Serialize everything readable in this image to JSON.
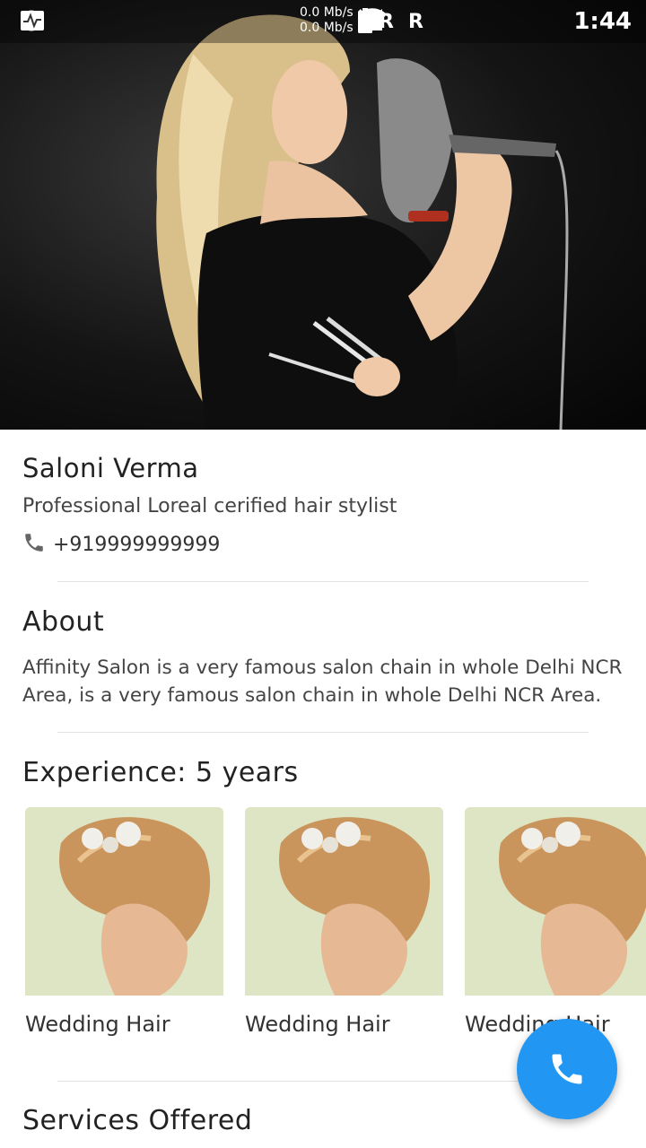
{
  "status_bar": {
    "speed_up": "0.0 Mb/s",
    "speed_down": "0.0 Mb/s",
    "roaming_1": "R",
    "roaming_2": "R",
    "time": "1:44"
  },
  "profile": {
    "name": "Saloni Verma",
    "subtitle": "Professional Loreal cerified hair stylist",
    "phone": "+919999999999"
  },
  "about": {
    "title": "About",
    "text": "Affinity Salon is a very famous salon chain in whole Delhi NCR Area, is a very famous salon chain in whole Delhi NCR Area."
  },
  "experience": {
    "title": "Experience: 5 years",
    "cards": [
      {
        "label": "Wedding Hair"
      },
      {
        "label": "Wedding Hair"
      },
      {
        "label": "Wedding Hair"
      }
    ]
  },
  "services": {
    "title": "Services Offered"
  },
  "colors": {
    "accent": "#2196f3"
  }
}
